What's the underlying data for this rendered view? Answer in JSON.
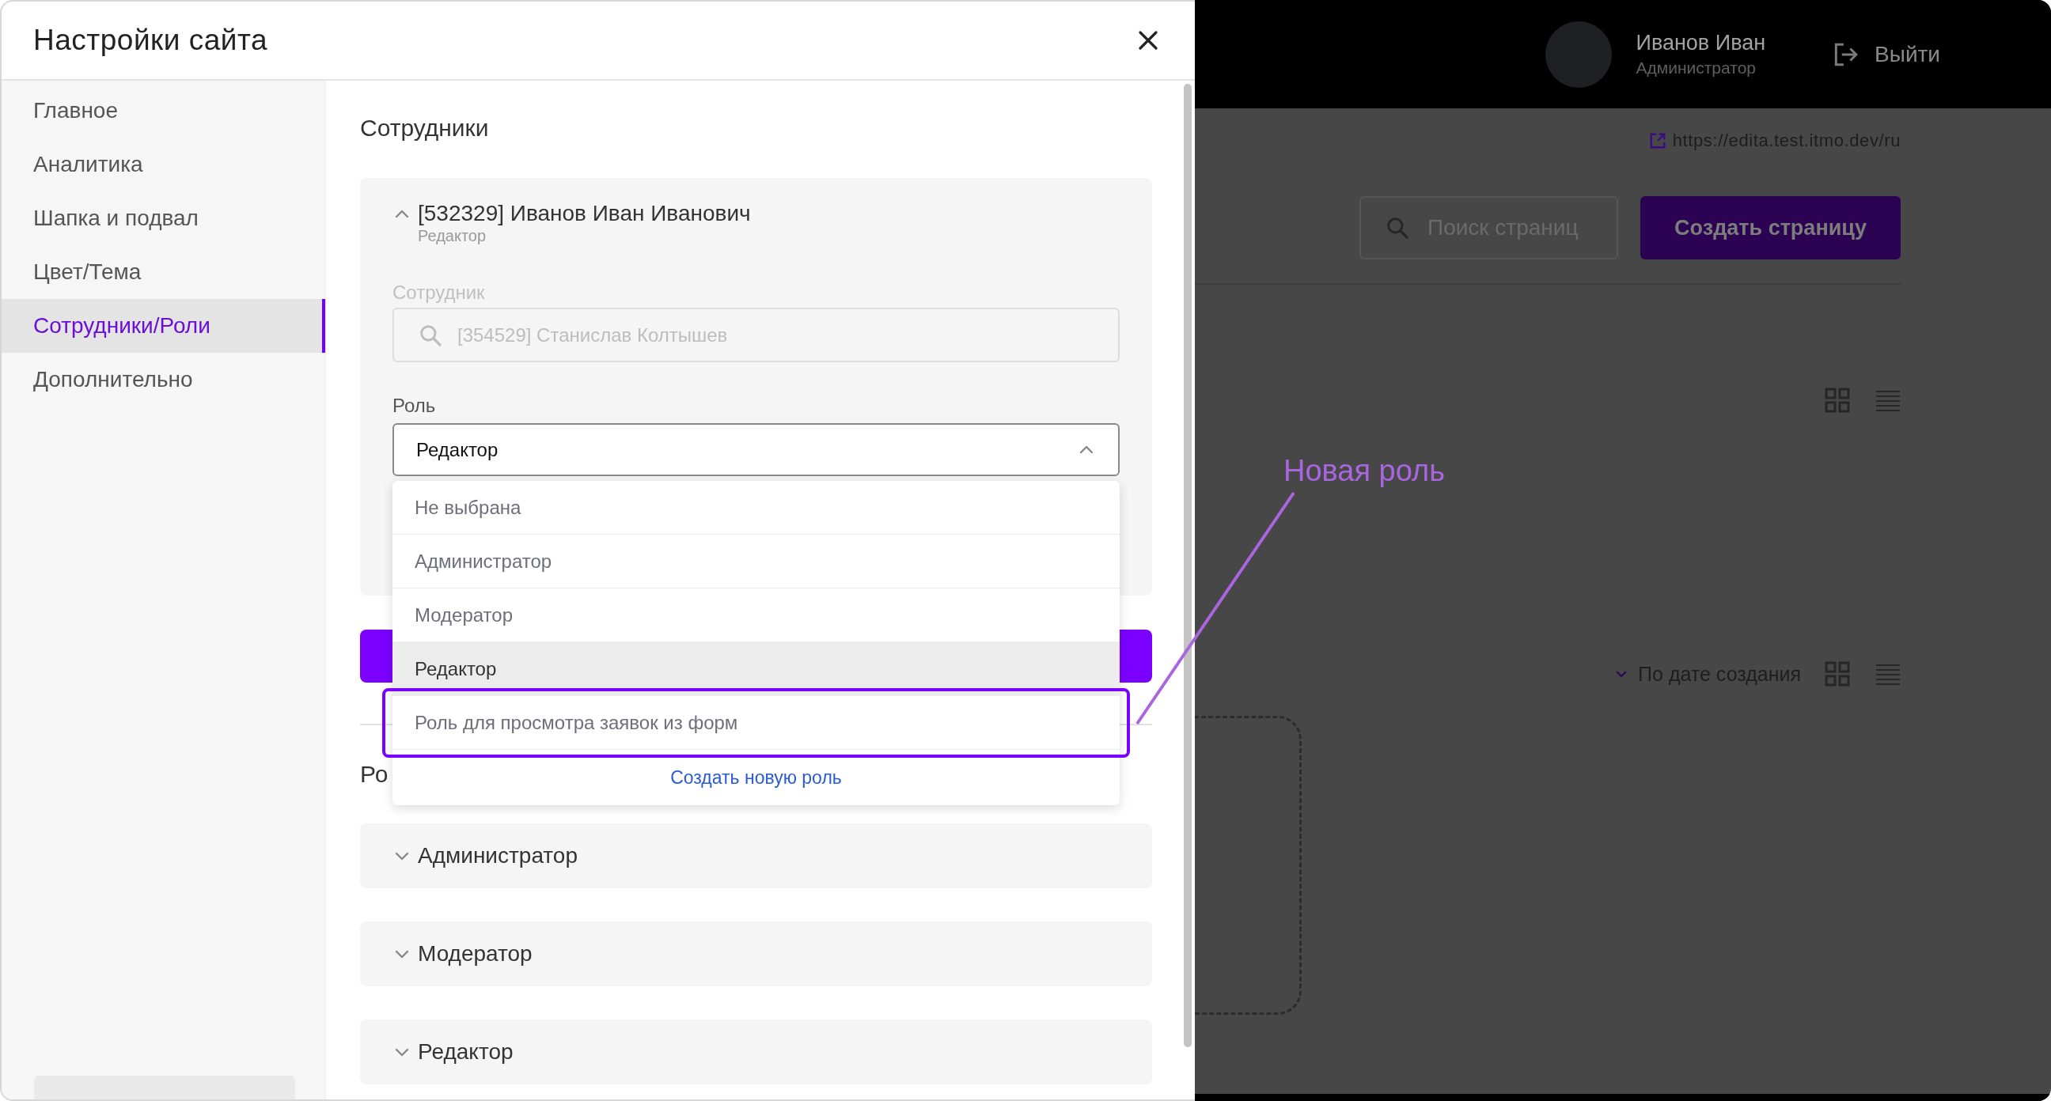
{
  "modal": {
    "title": "Настройки сайта",
    "nav": [
      {
        "label": "Главное",
        "selected": false
      },
      {
        "label": "Аналитика",
        "selected": false
      },
      {
        "label": "Шапка и подвал",
        "selected": false
      },
      {
        "label": "Цвет/Тема",
        "selected": false
      },
      {
        "label": "Сотрудники/Роли",
        "selected": true
      },
      {
        "label": "Дополнительно",
        "selected": false
      }
    ],
    "section_title": "Сотрудники",
    "employee": {
      "name": "[532329] Иванов Иван Иванович",
      "role": "Редактор",
      "expanded": true,
      "employee_label": "Сотрудник",
      "employee_value": "[354529] Станислав Колтышев",
      "employee_disabled": true,
      "role_label": "Роль",
      "role_value": "Редактор",
      "dropdown_open": true,
      "options": [
        {
          "label": "Не выбрана",
          "selected": false,
          "highlighted": false
        },
        {
          "label": "Администратор",
          "selected": false,
          "highlighted": false
        },
        {
          "label": "Модератор",
          "selected": false,
          "highlighted": false
        },
        {
          "label": "Редактор",
          "selected": true,
          "highlighted": false
        },
        {
          "label": "Роль для просмотра заявок из форм",
          "selected": false,
          "highlighted": true
        }
      ],
      "create_link": "Создать новую роль"
    },
    "roles_heading": "Ро",
    "roles": [
      {
        "label": "Администратор",
        "expanded": false
      },
      {
        "label": "Модератор",
        "expanded": false
      },
      {
        "label": "Редактор",
        "expanded": false
      }
    ]
  },
  "annotation": {
    "label": "Новая роль"
  },
  "background": {
    "user_name": "Иванов Иван",
    "user_role": "Администратор",
    "logout": "Выйти",
    "site_url": "https://edita.test.itmo.dev/ru",
    "search_placeholder": "Поиск страниц",
    "create_button": "Создать страницу",
    "sort_label": "По дате создания"
  }
}
